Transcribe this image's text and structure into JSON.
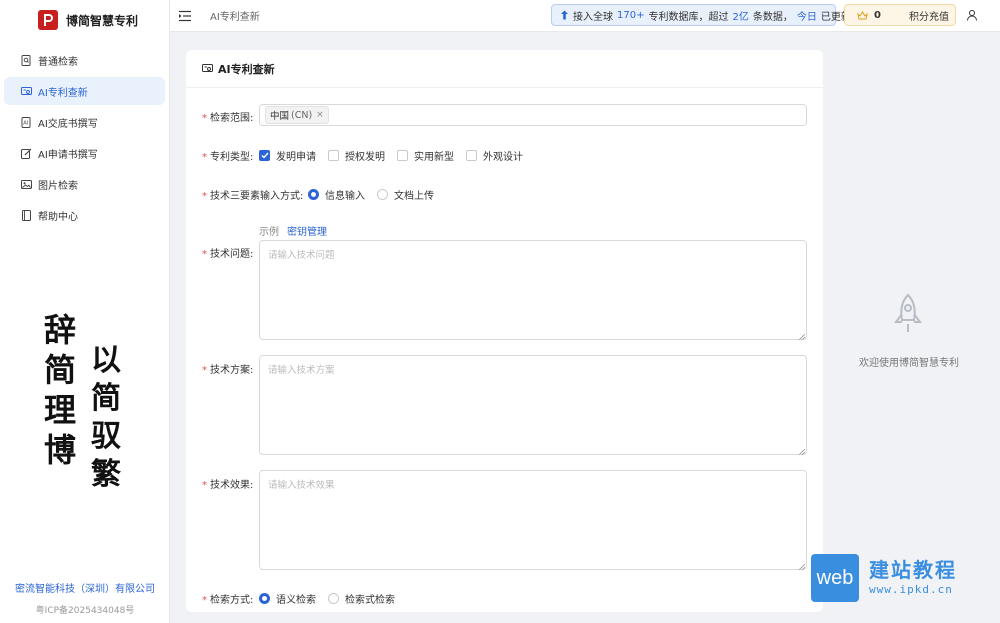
{
  "app": {
    "title": "博简智慧专利",
    "brand_color": "#c81e1e",
    "accent": "#2b64d6"
  },
  "sidebar": {
    "items": [
      {
        "label": "普通检索",
        "icon": "search-doc-icon",
        "active": false
      },
      {
        "label": "AI专利查新",
        "icon": "ai-check-icon",
        "active": true
      },
      {
        "label": "AI交底书撰写",
        "icon": "ai-doc-icon",
        "active": false
      },
      {
        "label": "AI申请书撰写",
        "icon": "edit-icon",
        "active": false
      },
      {
        "label": "图片检索",
        "icon": "image-icon",
        "active": false
      },
      {
        "label": "帮助中心",
        "icon": "book-icon",
        "active": false
      }
    ],
    "calligraphy": {
      "col1": "辞简理博",
      "col2": "以简驭繁"
    },
    "company": "密流智能科技（深圳）有限公司",
    "icp": "粤ICP备2025434048号"
  },
  "topbar": {
    "breadcrumb": "AI专利查新",
    "notice": {
      "p1": "接入全球",
      "count": "170+",
      "p2": "专利数据库，超过",
      "amount": "2亿",
      "p3": "条数据，",
      "today": "今日",
      "p4": "已更新"
    },
    "points_value": "0",
    "recharge_label": "积分充值"
  },
  "form": {
    "title": "AI专利查新",
    "scope_label": "检索范围:",
    "scope_tag": {
      "name": "中国",
      "code": "(CN)"
    },
    "type_label": "专利类型:",
    "types": [
      {
        "label": "发明申请",
        "checked": true
      },
      {
        "label": "授权发明",
        "checked": false
      },
      {
        "label": "实用新型",
        "checked": false
      },
      {
        "label": "外观设计",
        "checked": false
      }
    ],
    "input_mode_label": "技术三要素输入方式:",
    "input_modes": [
      {
        "label": "信息输入",
        "selected": true
      },
      {
        "label": "文档上传",
        "selected": false
      }
    ],
    "example_link": "示例",
    "key_link": "密钥管理",
    "problem_label": "技术问题:",
    "problem_placeholder": "请输入技术问题",
    "solution_label": "技术方案:",
    "solution_placeholder": "请输入技术方案",
    "effect_label": "技术效果:",
    "effect_placeholder": "请输入技术效果",
    "search_mode_label": "检索方式:",
    "search_modes": [
      {
        "label": "语义检索",
        "selected": true
      },
      {
        "label": "检索式检索",
        "selected": false
      }
    ]
  },
  "right_panel": {
    "welcome": "欢迎使用博简智慧专利",
    "icon": "rocket-icon"
  },
  "watermark": {
    "box": "web",
    "cn": "建站教程",
    "url": "www.ipkd.cn"
  }
}
